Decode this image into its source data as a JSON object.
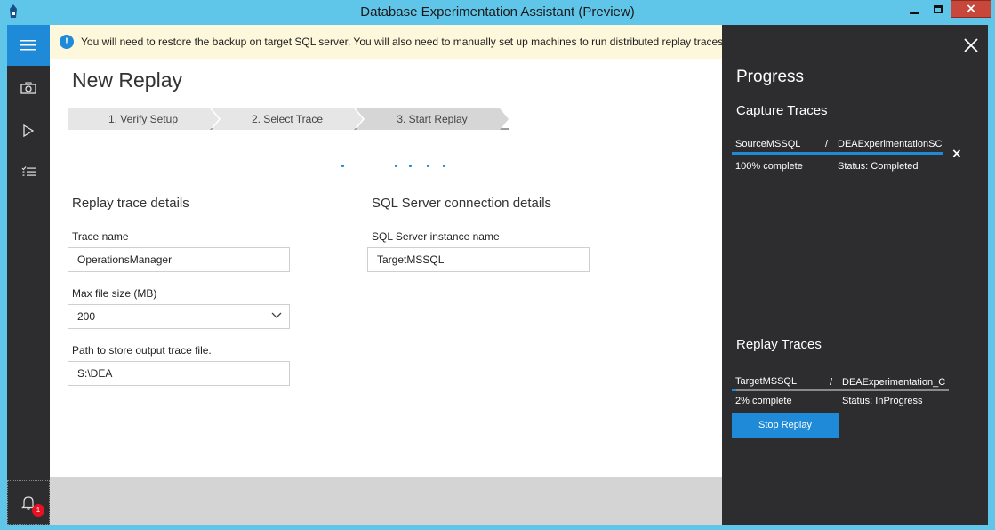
{
  "window": {
    "title": "Database Experimentation Assistant (Preview)",
    "app_icon": "dea-app-icon",
    "controls": {
      "minimize": "minimize-icon",
      "maximize": "maximize-icon",
      "close": "×"
    }
  },
  "nav": {
    "items": [
      {
        "name": "menu",
        "icon": "hamburger-icon"
      },
      {
        "name": "capture",
        "icon": "camera-icon"
      },
      {
        "name": "replay",
        "icon": "play-icon"
      },
      {
        "name": "analysis",
        "icon": "checklist-icon"
      }
    ],
    "notifications": {
      "icon": "bell-icon",
      "count": "1"
    }
  },
  "banner": {
    "icon": "info-icon",
    "icon_glyph": "!",
    "text": "You will need to restore the backup on target SQL server. You will also need to manually set up machines to run distributed replay traces"
  },
  "page": {
    "title": "New Replay",
    "steps": [
      "1. Verify Setup",
      "2. Select Trace",
      "3. Start Replay"
    ],
    "active_step": 3
  },
  "replay_details": {
    "section_title": "Replay trace details",
    "trace_name_label": "Trace name",
    "trace_name_value": "OperationsManager",
    "max_file_size_label": "Max file size (MB)",
    "max_file_size_value": "200",
    "path_label": "Path to store output trace file.",
    "path_value": "S:\\DEA"
  },
  "connection_details": {
    "section_title": "SQL Server connection details",
    "instance_label": "SQL Server instance name",
    "instance_value": "TargetMSSQL"
  },
  "progress_panel": {
    "title": "Progress",
    "close_glyph": "×",
    "capture": {
      "section_title": "Capture Traces",
      "server": "SourceMSSQL",
      "separator": "/",
      "trace": "DEAExperimentationSC",
      "progress_percent": 100,
      "complete_text": "100% complete",
      "status_text": "Status: Completed",
      "remove_glyph": "×"
    },
    "replay": {
      "section_title": "Replay Traces",
      "server": "TargetMSSQL",
      "separator": "/",
      "trace": "DEAExperimentation_C",
      "progress_percent": 2,
      "complete_text": "2% complete",
      "status_text": "Status: InProgress",
      "stop_button": "Stop Replay"
    }
  },
  "colors": {
    "accent": "#1e8ad8",
    "titlebar": "#5fc6ea",
    "dark_panel": "#2d2d30",
    "banner_bg": "#fdf7dc",
    "close_red": "#c7483a",
    "badge_red": "#e81123"
  }
}
